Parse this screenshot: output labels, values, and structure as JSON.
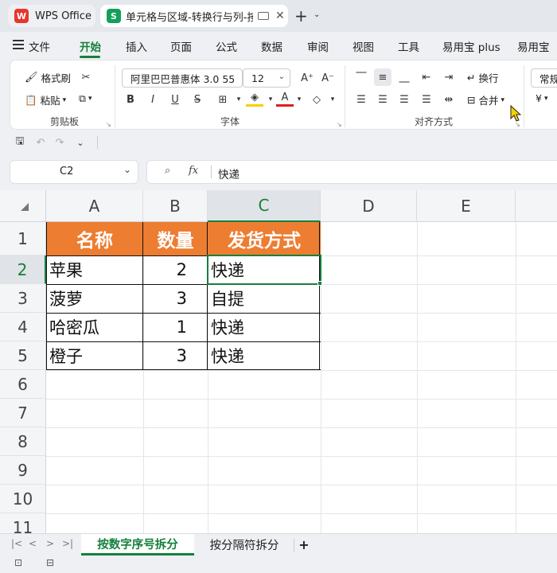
{
  "titlebar": {
    "home_tab": "WPS Office",
    "home_logo": "W",
    "doc_tab": "单元格与区域-转换行与列-按",
    "doc_logo": "S"
  },
  "menu": {
    "file": "文件",
    "items": [
      "开始",
      "插入",
      "页面",
      "公式",
      "数据",
      "审阅",
      "视图",
      "工具",
      "易用宝 plus",
      "易用宝"
    ]
  },
  "ribbon": {
    "format_painter": "格式刷",
    "paste": "粘贴",
    "clipboard_group": "剪贴板",
    "font_name": "阿里巴巴普惠体 3.0 55",
    "font_size": "12",
    "font_group": "字体",
    "wrap": "换行",
    "merge": "合并",
    "align_group": "对齐方式",
    "number_format": "常规",
    "currency_symbol": "¥"
  },
  "formula_bar": {
    "name_box": "C2",
    "fx_label": "fx",
    "content": "快递"
  },
  "grid": {
    "columns": [
      "A",
      "B",
      "C",
      "D",
      "E"
    ],
    "rows": [
      "1",
      "2",
      "3",
      "4",
      "5",
      "6",
      "7",
      "8",
      "9",
      "10",
      "11"
    ],
    "headers": [
      "名称",
      "数量",
      "发货方式"
    ],
    "data": [
      [
        "苹果",
        "2",
        "快递"
      ],
      [
        "菠萝",
        "3",
        "自提"
      ],
      [
        "哈密瓜",
        "1",
        "快递"
      ],
      [
        "橙子",
        "3",
        "快递"
      ]
    ],
    "header_fill": "#ed7d31",
    "selection_color": "#15803d"
  },
  "sheets": {
    "tabs": [
      "按数字序号拆分",
      "按分隔符拆分"
    ],
    "add": "+"
  }
}
